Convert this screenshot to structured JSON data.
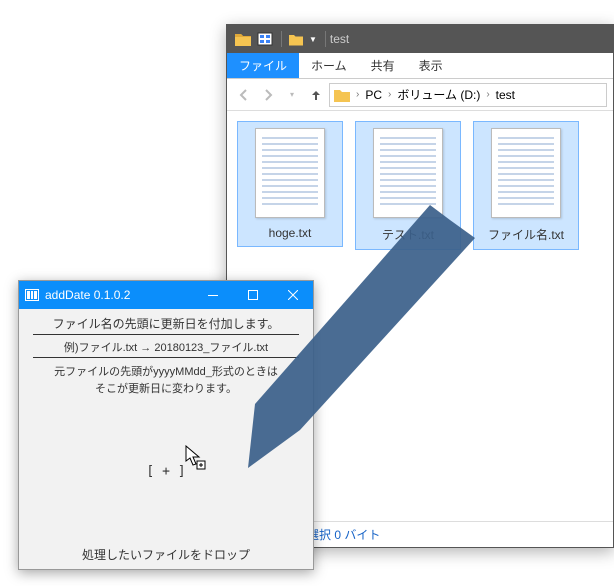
{
  "explorer": {
    "title": "test",
    "tabs": {
      "file": "ファイル",
      "home": "ホーム",
      "share": "共有",
      "view": "表示"
    },
    "breadcrumb": [
      "PC",
      "ボリューム (D:)",
      "test"
    ],
    "files": [
      {
        "name": "hoge.txt"
      },
      {
        "name": "テスト.txt"
      },
      {
        "name": "ファイル名.txt"
      }
    ],
    "status": "3 個の項目を選択 0 バイト"
  },
  "adddate": {
    "title": "addDate 0.1.0.2",
    "heading": "ファイル名の先頭に更新日を付加します。",
    "example": "例)ファイル.txt → 20180123_ファイル.txt",
    "note_line1": "元ファイルの先頭がyyyyMMdd_形式のときは",
    "note_line2": "そこが更新日に変わります。",
    "drop_label": "[ + ]",
    "footer": "処理したいファイルをドロップ"
  },
  "colors": {
    "explorer_accent": "#1e90ff",
    "adddate_accent": "#0b8efb"
  }
}
